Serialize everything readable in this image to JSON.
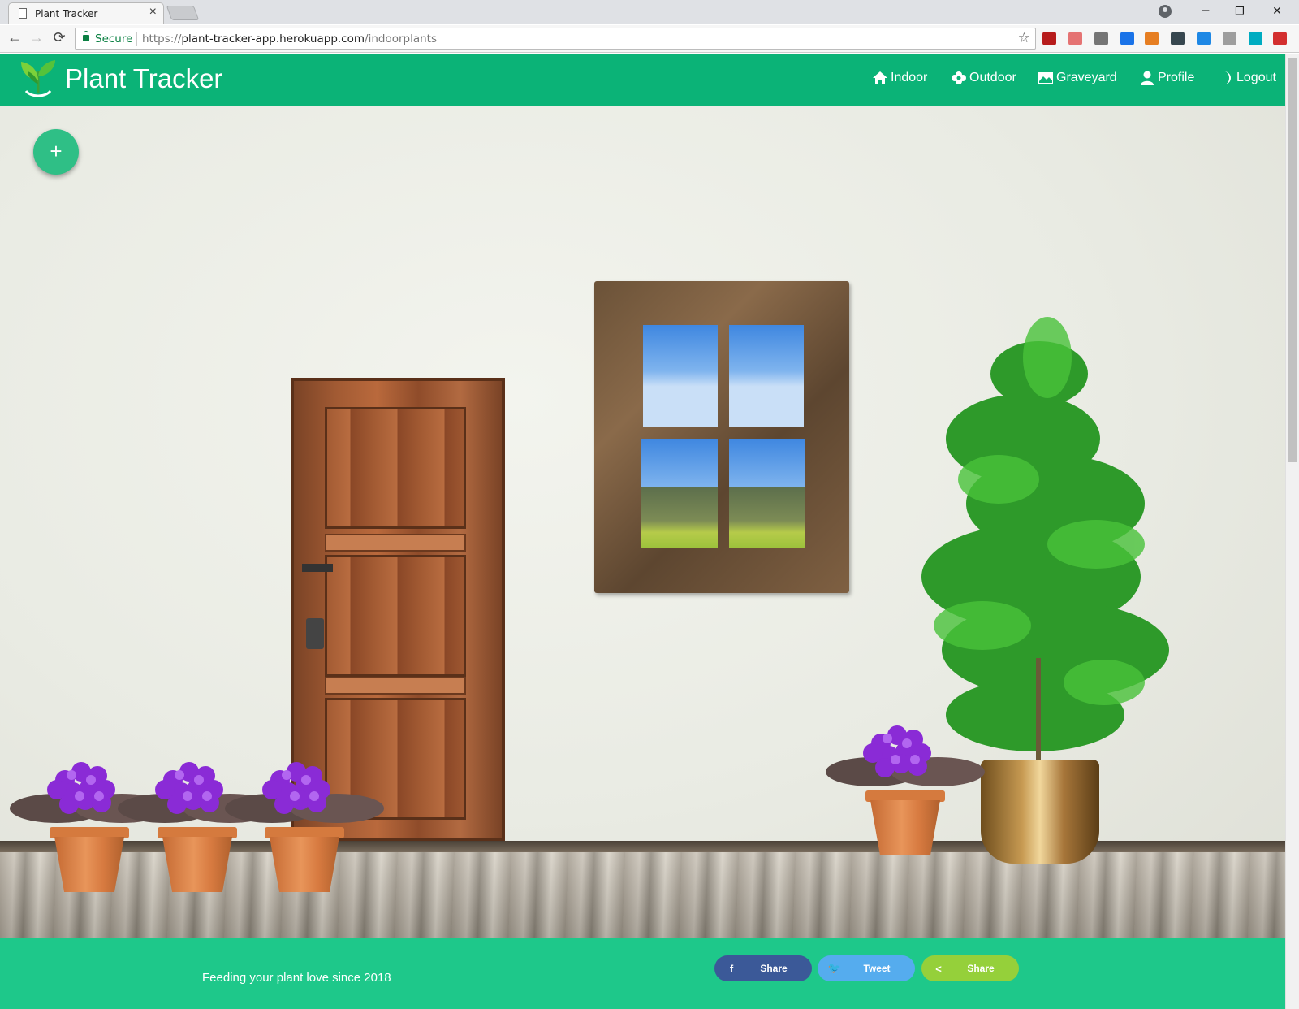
{
  "browser": {
    "tab_title": "Plant Tracker",
    "tab_close": "×",
    "secure_label": "Secure",
    "url_scheme": "https://",
    "url_host": "plant-tracker-app.herokuapp.com",
    "url_path": "/indoorplants",
    "window_minimize": "–",
    "window_restore": "❐",
    "window_close": "✕",
    "back_icon": "←",
    "forward_icon": "→",
    "reload_icon": "⟳",
    "star_icon": "☆",
    "extension_colors": [
      "#b71c1c",
      "#e57373",
      "#757575",
      "#1a73e8",
      "#e67e22",
      "#37474f",
      "#1e88e5",
      "#9e9e9e",
      "#00acc1",
      "#d32f2f"
    ]
  },
  "navbar": {
    "brand": "Plant Tracker",
    "items": [
      {
        "label": "Indoor",
        "icon": "home-icon"
      },
      {
        "label": "Outdoor",
        "icon": "flower-icon"
      },
      {
        "label": "Graveyard",
        "icon": "image-icon"
      },
      {
        "label": "Profile",
        "icon": "person-icon"
      },
      {
        "label": "Logout",
        "icon": "moon-icon"
      }
    ],
    "color": "#0bb377"
  },
  "main": {
    "add_button_label": "+"
  },
  "footer": {
    "tagline": "Feeding your plant love since 2018",
    "color": "#1ec88a",
    "share_buttons": [
      {
        "label": "Share",
        "icon": "f",
        "color": "#3b5998"
      },
      {
        "label": "Tweet",
        "icon": "🐦",
        "color": "#55acee"
      },
      {
        "label": "Share",
        "icon": "<",
        "color": "#95d03a"
      }
    ]
  }
}
